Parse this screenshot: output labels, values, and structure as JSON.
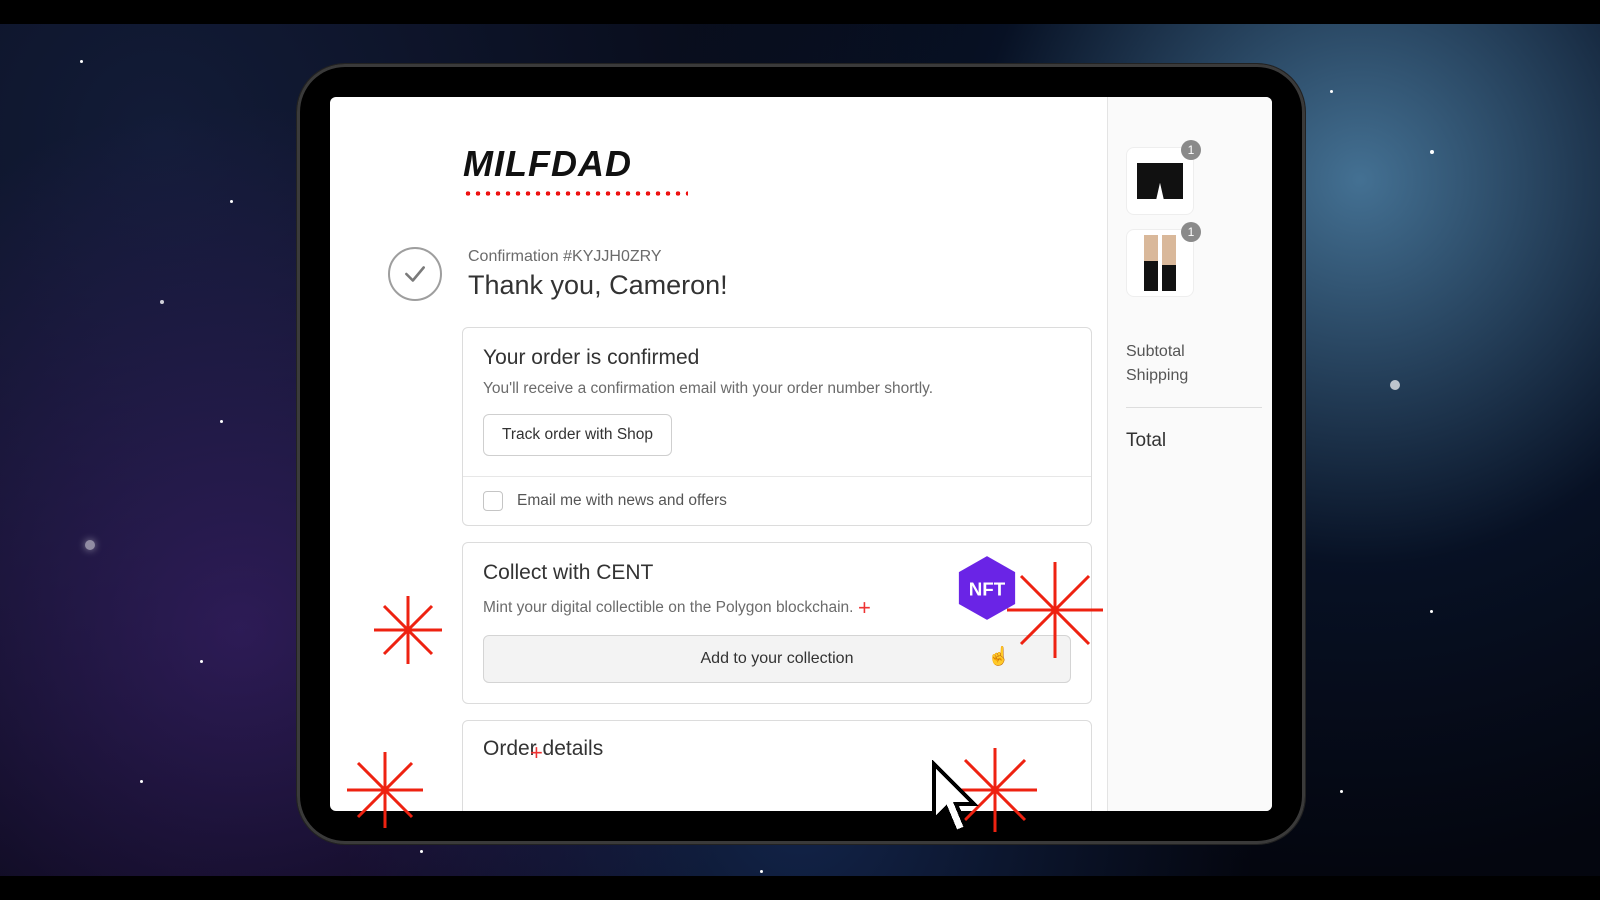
{
  "brand": "MILFDAD",
  "header": {
    "confirmation_label": "Confirmation #KYJJH0ZRY",
    "thank_you": "Thank you, Cameron!"
  },
  "confirmed_card": {
    "title": "Your order is confirmed",
    "body": "You'll receive a confirmation email with your order number shortly.",
    "track_label": "Track order with Shop",
    "newsletter_label": "Email me with news and offers"
  },
  "cent_card": {
    "title": "Collect with CENT",
    "body": "Mint your digital collectible on the Polygon blockchain.",
    "button_label": "Add to your collection",
    "nft_label": "NFT"
  },
  "details_card": {
    "title": "Order details"
  },
  "sidebar": {
    "items": [
      {
        "qty": "1",
        "name": "boxers-thumb"
      },
      {
        "qty": "1",
        "name": "socks-thumb"
      }
    ],
    "subtotal_label": "Subtotal",
    "shipping_label": "Shipping",
    "total_label": "Total"
  },
  "colors": {
    "accent_red": "#e21",
    "nft_purple": "#6a24e6"
  }
}
